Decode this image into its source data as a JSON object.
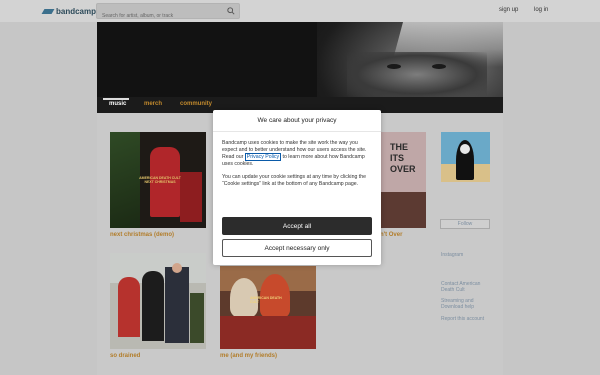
{
  "topbar": {
    "logo_text": "bandcamp",
    "search_placeholder": "Search for artist, album, or track",
    "signup": "sign up",
    "login": "log in"
  },
  "nav": {
    "tabs": [
      {
        "label": "music",
        "active": true
      },
      {
        "label": "merch",
        "active": false
      },
      {
        "label": "community",
        "active": false
      }
    ]
  },
  "albums": [
    {
      "title": "next christmas (demo)"
    },
    {
      "title": "n't Over"
    },
    {
      "title": "so drained"
    },
    {
      "title": "me (and my friends)"
    }
  ],
  "sidebar": {
    "follow_label": "Follow",
    "links": [
      "Instagram",
      "Contact American Death Cult",
      "Streaming and Download help",
      "Report this account"
    ]
  },
  "modal": {
    "title": "We care about your privacy",
    "body_part1": "Bandcamp uses cookies to make the site work the way you expect and to better understand how our users access the site. Read our ",
    "privacy_link": "Privacy Policy",
    "body_part2": " to learn more about how Bandcamp uses cookies.",
    "body2": "You can update your cookie settings at any time by clicking the “Cookie settings” link at the bottom of any Bandcamp page.",
    "accept_all": "Accept all",
    "accept_necessary": "Accept necessary only"
  },
  "colors": {
    "accent": "#c28a2d",
    "link": "#0a5aa8"
  }
}
